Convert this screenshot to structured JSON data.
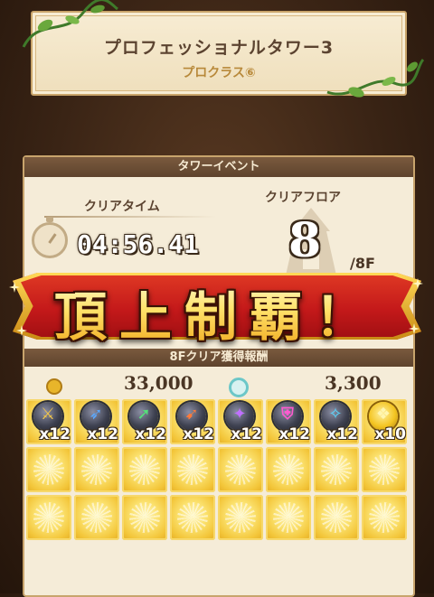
{
  "header": {
    "title": "プロフェッショナルタワー3",
    "subtitle": "プロクラス⑥"
  },
  "event": {
    "panel_title": "タワーイベント",
    "clear_time_label": "クリアタイム",
    "clear_time": "04:56.41",
    "clear_floor_label": "クリアフロア",
    "clear_floor": "8",
    "total_floors": "/8F"
  },
  "banner": {
    "text": "頂上制覇！"
  },
  "rewards": {
    "title": "8Fクリア獲得報酬",
    "gold": "33,000",
    "essence": "3,300",
    "items": [
      {
        "icon": "sword-orb-icon",
        "glyph": "⚔",
        "color": "#f2c64a",
        "count": "x12"
      },
      {
        "icon": "spear-orb-icon",
        "glyph": "➶",
        "color": "#5aa8ff",
        "count": "x12"
      },
      {
        "icon": "arrow-orb-icon",
        "glyph": "➚",
        "color": "#55e07a",
        "count": "x12"
      },
      {
        "icon": "bow-orb-icon",
        "glyph": "➹",
        "color": "#ff7a3a",
        "count": "x12"
      },
      {
        "icon": "staff-orb-icon",
        "glyph": "✦",
        "color": "#c070ff",
        "count": "x12"
      },
      {
        "icon": "shield-orb-icon",
        "glyph": "⛨",
        "color": "#ff5ad0",
        "count": "x12"
      },
      {
        "icon": "wand-orb-icon",
        "glyph": "✧",
        "color": "#58d8ff",
        "count": "x12"
      },
      {
        "icon": "gold-crystal-icon",
        "glyph": "❖",
        "color": "#fff6b0",
        "count": "x10"
      }
    ]
  }
}
